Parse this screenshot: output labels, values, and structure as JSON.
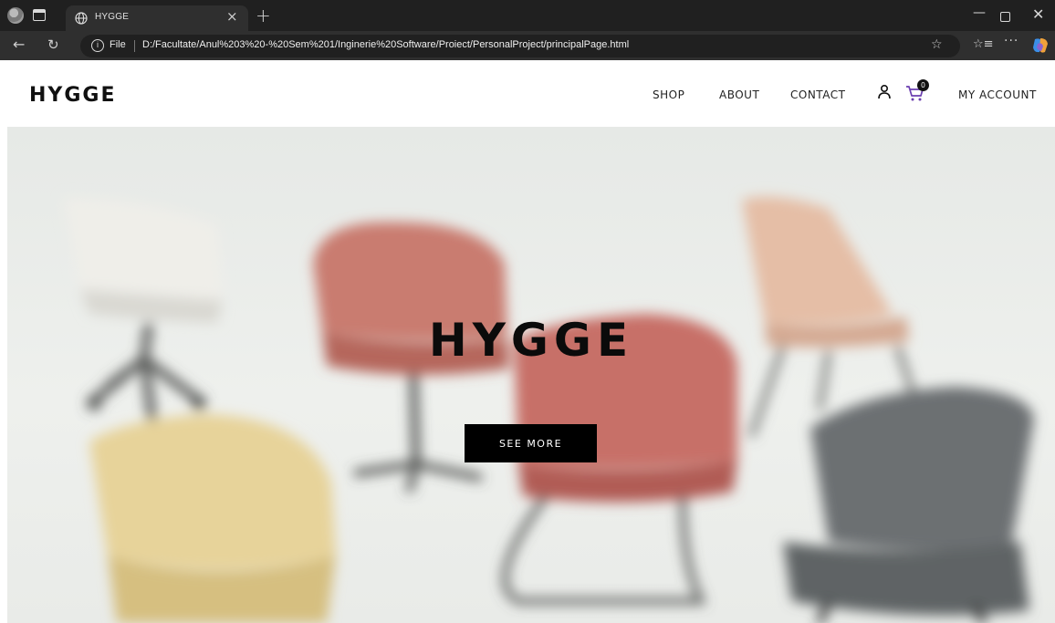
{
  "browser": {
    "tab_title": "HYGGE",
    "new_tab": "+",
    "tab_close": "×",
    "file_label": "File",
    "info_glyph": "i",
    "url": "D:/Facultate/Anul%203%20-%20Sem%201/Inginerie%20Software/Proiect/PersonalProject/principalPage.html",
    "icons": [
      "profile-icon",
      "tab-actions-icon",
      "globe-icon",
      "back-icon",
      "reload-icon",
      "info-icon",
      "star-icon",
      "favorites-icon",
      "more-icon",
      "copilot-icon",
      "minimize-icon",
      "maximize-icon",
      "close-icon"
    ]
  },
  "header": {
    "logo": "HYGGE",
    "nav": {
      "shop": "SHOP",
      "about": "ABOUT",
      "contact": "CONTACT",
      "account": "MY ACCOUNT"
    },
    "cart_count": "0"
  },
  "hero": {
    "title": "HYGGE",
    "button": "SEE MORE"
  },
  "colors": {
    "chrome_dark": "#202020",
    "toolbar": "#2f2f2f",
    "button_bg": "#000000",
    "button_text": "#ffffff",
    "hero_bg": "#e8ebe8"
  }
}
